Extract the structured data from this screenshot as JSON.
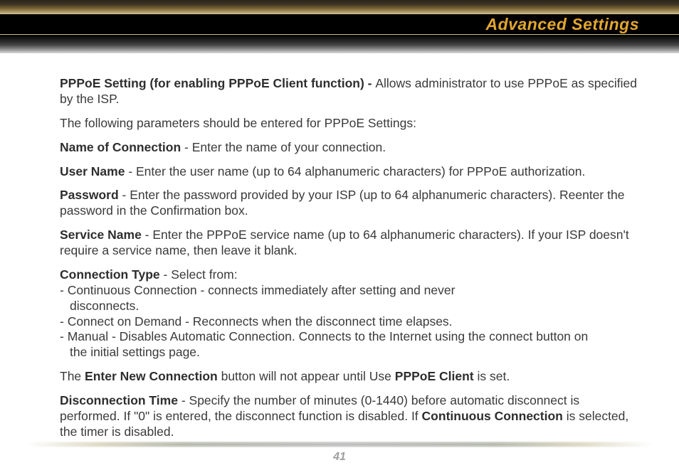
{
  "header": {
    "title": "Advanced Settings"
  },
  "body": {
    "p1": {
      "bold": "PPPoE Setting (for enabling PPPoE Client function) - ",
      "rest": "Allows administrator to use PPPoE as specified by the ISP."
    },
    "p2": "The following parameters should be entered for PPPoE Settings:",
    "p3": {
      "bold": "Name of Connection",
      "rest": " - Enter the name of your connection."
    },
    "p4": {
      "bold": "User Name",
      "rest": " - Enter the user name (up to 64 alphanumeric characters) for PPPoE authorization."
    },
    "p5": {
      "bold": "Password",
      "rest": " - Enter the password provided by your ISP (up to 64 alphanumeric characters).  Reenter the password in the Confirmation box."
    },
    "p6": {
      "bold": "Service Name",
      "rest": " - Enter the PPPoE service name (up to 64 alphanumeric characters).  If your ISP doesn't require a service name, then leave it blank."
    },
    "p7": {
      "bold": "Connection Type",
      "rest": " - Select from:",
      "opt1": "- Continuous Connection - connects immediately after setting and never",
      "opt1b": "disconnects.",
      "opt2": "- Connect on Demand - Reconnects when the disconnect time elapses.",
      "opt3": "- Manual - Disables Automatic Connection.  Connects to the Internet using  the connect button on",
      "opt3b": "the initial settings page."
    },
    "p8": {
      "pre": "The ",
      "b1": "Enter New Connection",
      "mid": " button will not appear until Use ",
      "b2": "PPPoE Client",
      "post": " is set."
    },
    "p9": {
      "bold": "Disconnection Time",
      "mid": " - Specify the number of minutes (0-1440) before automatic disconnect is performed.  If \"0\" is entered, the disconnect function is disabled.  If ",
      "b2": "Continuous Connection",
      "post": " is selected, the timer is disabled."
    }
  },
  "footer": {
    "page_number": "41"
  }
}
